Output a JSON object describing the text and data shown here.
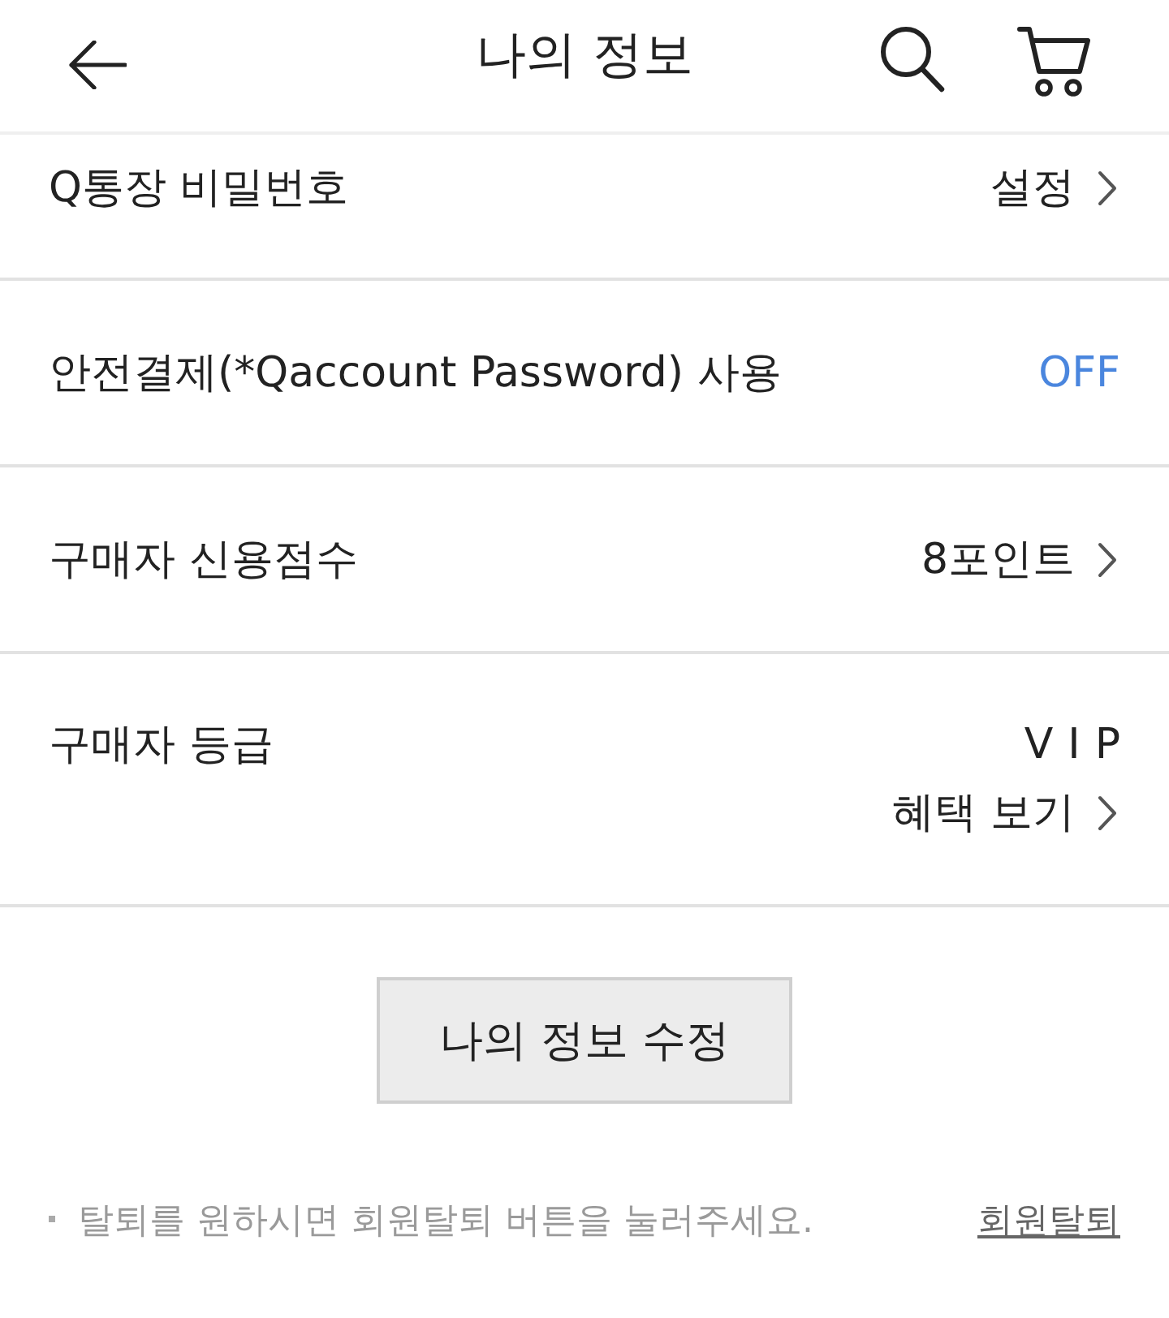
{
  "header": {
    "title": "나의 정보"
  },
  "settings": [
    {
      "kind": "link",
      "label": "Q통장 비밀번호",
      "value": "설정"
    },
    {
      "kind": "toggle",
      "label": "안전결제(*Qaccount Password) 사용",
      "value": "OFF",
      "on": false
    },
    {
      "kind": "link",
      "label": "구매자 신용점수",
      "value": "8포인트"
    },
    {
      "kind": "grade",
      "label": "구매자 등급",
      "value": "VIP",
      "link": "혜택 보기"
    }
  ],
  "edit_button": {
    "label": "나의 정보 수정"
  },
  "footer": {
    "notice": "탈퇴를 원하시면 회원탈퇴 버튼을 눌러주세요.",
    "withdraw_link": "회원탈퇴"
  }
}
